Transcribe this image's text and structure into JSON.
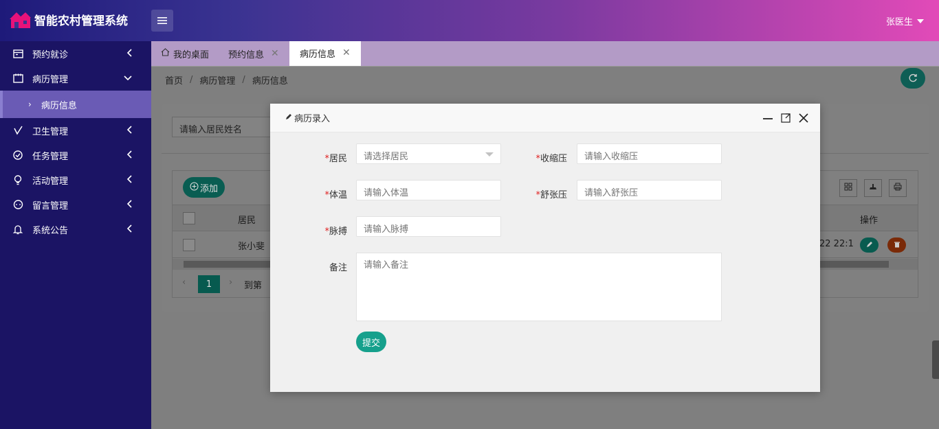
{
  "header": {
    "app_title": "智能农村管理系统",
    "user_name": "张医生"
  },
  "sidebar": {
    "items": [
      {
        "label": "预约就诊",
        "icon": "calendar-icon"
      },
      {
        "label": "病历管理",
        "icon": "notebook-icon"
      },
      {
        "label": "病历信息",
        "sub": true
      },
      {
        "label": "卫生管理",
        "icon": "brush-icon"
      },
      {
        "label": "任务管理",
        "icon": "check-circle-icon"
      },
      {
        "label": "活动管理",
        "icon": "lightbulb-icon"
      },
      {
        "label": "留言管理",
        "icon": "chat-icon"
      },
      {
        "label": "系统公告",
        "icon": "bell-icon"
      }
    ]
  },
  "tabs": [
    {
      "label": "我的桌面",
      "icon": "home-icon"
    },
    {
      "label": "预约信息"
    },
    {
      "label": "病历信息",
      "active": true
    }
  ],
  "breadcrumb": [
    "首页",
    "病历管理",
    "病历信息"
  ],
  "list": {
    "search_placeholder": "请输入居民姓名",
    "add_label": "添加",
    "columns": [
      "居民",
      "操作"
    ],
    "rows": [
      {
        "resident": "张小斐",
        "time_fragment": "22 22:1"
      }
    ],
    "pager": {
      "current": "1",
      "goto_label": "到第"
    }
  },
  "modal": {
    "title": "病历录入",
    "fields": {
      "resident": {
        "label": "居民",
        "placeholder": "请选择居民"
      },
      "systolic": {
        "label": "收缩压",
        "placeholder": "请输入收缩压"
      },
      "temperature": {
        "label": "体温",
        "placeholder": "请输入体温"
      },
      "diastolic": {
        "label": "舒张压",
        "placeholder": "请输入舒张压"
      },
      "pulse": {
        "label": "脉搏",
        "placeholder": "请输入脉搏"
      },
      "remark": {
        "label": "备注",
        "placeholder": "请输入备注"
      }
    },
    "submit_label": "提交"
  },
  "colors": {
    "sidebar_bg": "#1b1464",
    "accent": "#16a08c",
    "required": "#e02020"
  }
}
